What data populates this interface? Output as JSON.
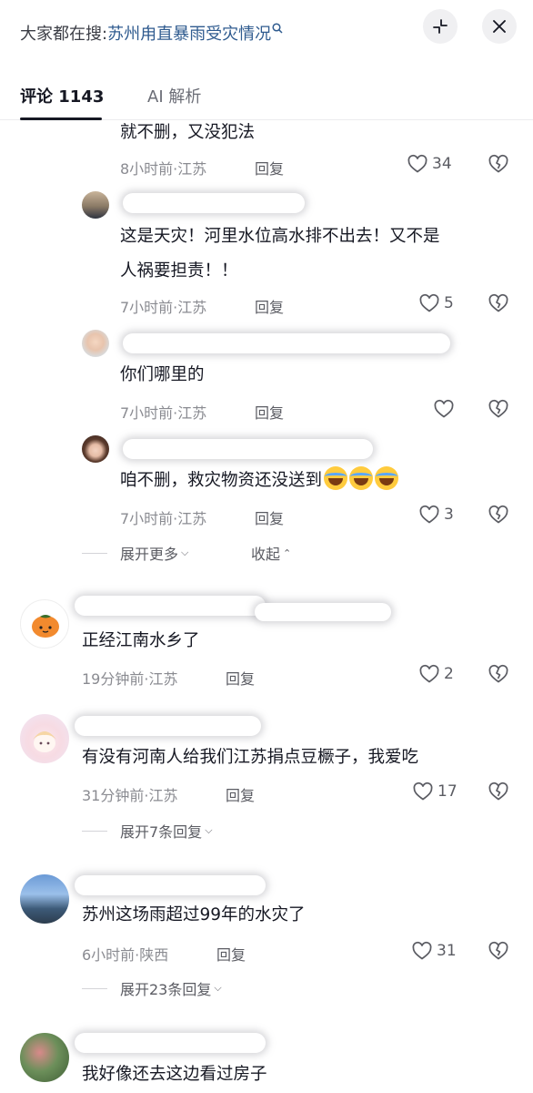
{
  "header": {
    "search_prefix": "大家都在搜:",
    "search_query": "苏州甪直暴雨受灾情况",
    "search_icon": "search-icon"
  },
  "tabs": [
    {
      "label": "评论 1143",
      "active": true
    },
    {
      "label": "AI 解析",
      "active": false
    }
  ],
  "comments": [
    {
      "text": "就不删，又没犯法",
      "time_loc": "8小时前·江苏",
      "reply": "回复",
      "likes": "34"
    },
    {
      "text_line1": "这是天灾！河里水位高水排不出去！又不是",
      "text_line2": "人祸要担责！！",
      "time_loc": "7小时前·江苏",
      "reply": "回复",
      "likes": "5"
    },
    {
      "text": "你们哪里的",
      "time_loc": "7小时前·江苏",
      "reply": "回复",
      "likes": ""
    },
    {
      "text": "咱不删，救灾物资还没送到",
      "time_loc": "7小时前·江苏",
      "reply": "回复",
      "likes": "3",
      "emoji": "face-with-tears-of-joy"
    },
    {
      "text": "正经江南水乡了",
      "time_loc": "19分钟前·江苏",
      "reply": "回复",
      "likes": "2"
    },
    {
      "text": "有没有河南人给我们江苏捐点豆橛子，我爱吃",
      "time_loc": "31分钟前·江苏",
      "reply": "回复",
      "likes": "17"
    },
    {
      "text": "苏州这场雨超过99年的水灾了",
      "time_loc": "6小时前·陕西",
      "reply": "回复",
      "likes": "31"
    },
    {
      "text": "我好像还去这边看过房子"
    }
  ],
  "expand": {
    "more": "展开更多",
    "collapse": "收起",
    "replies_7": "展开7条回复",
    "replies_23": "展开23条回复"
  },
  "colors": {
    "accent_link": "#2f5b8f",
    "text": "#161823",
    "meta": "#8a8b91"
  }
}
